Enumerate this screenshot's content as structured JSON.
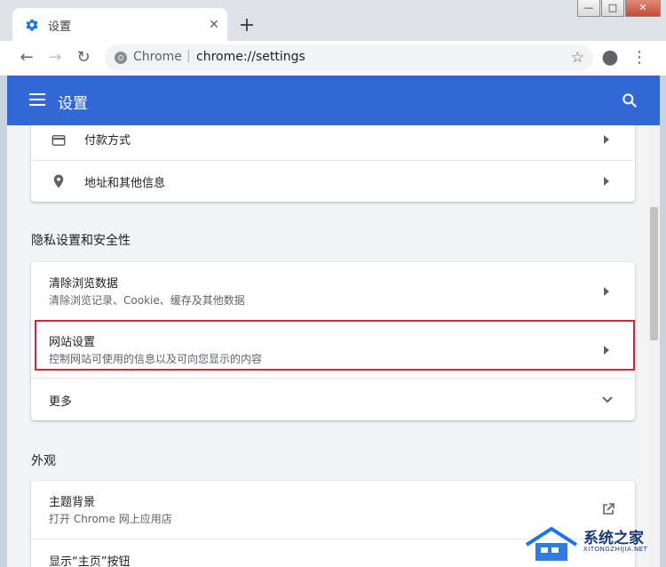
{
  "tab": {
    "title": "设置",
    "close": "✕"
  },
  "newtab": {
    "label": "+"
  },
  "window": {
    "minimize": "—",
    "maximize": "□",
    "close": "✕"
  },
  "toolbar": {
    "back": "←",
    "forward": "→",
    "reload": "↻",
    "profile": "●",
    "menu": "⋮"
  },
  "omnibox": {
    "site": "Chrome",
    "separator": "|",
    "url": "chrome://settings",
    "star": "☆"
  },
  "header": {
    "title": "设置"
  },
  "autofill": {
    "items": [
      {
        "title": "付款方式",
        "icon": "credit-card-icon"
      },
      {
        "title": "地址和其他信息",
        "icon": "location-pin-icon"
      }
    ]
  },
  "privacy": {
    "section_title": "隐私设置和安全性",
    "items": [
      {
        "title": "清除浏览数据",
        "subtitle": "清除浏览记录、Cookie、缓存及其他数据"
      },
      {
        "title": "网站设置",
        "subtitle": "控制网站可使用的信息以及可向您显示的内容"
      }
    ],
    "more": "更多"
  },
  "appearance": {
    "section_title": "外观",
    "items": [
      {
        "title": "主题背景",
        "subtitle": "打开 Chrome 网上应用店"
      },
      {
        "title": "显示“主页”按钮"
      }
    ]
  },
  "watermark": {
    "title": "系统之家",
    "subtitle": "XITONGZHIJIA.NET"
  },
  "colors": {
    "header_bg": "#3367d6",
    "highlight": "#d0273c",
    "content_bg": "#f1f3f4"
  }
}
